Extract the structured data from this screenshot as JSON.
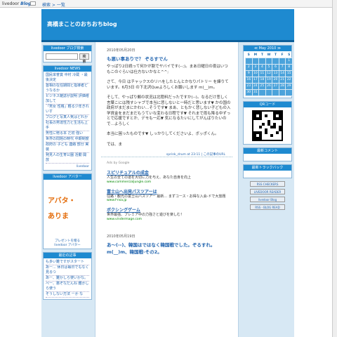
{
  "topbar": {
    "brand": "livedoor",
    "brand_blog": "Blog",
    "link": "検索 > 一覧"
  },
  "header": {
    "title": "高橋まことのおちおちblog"
  },
  "left": {
    "search_title": "livedoor ブログ検索",
    "search_button": "検索",
    "news_title": "livedoor NEWS",
    "news": [
      "国民栄誉賞 中村 冷蔵 ・最後決定",
      "首相の在任期間と指導者どうなるか",
      "ビジネス雑誌が説明 評価増加して",
      "「男女 性格」軽る少年きれいす",
      "ブログと写真人気はどれか",
      "社長の男達性力と生活も上手",
      "男性に贈る本 だ初 強い",
      "世界の問題の時代 中期制度",
      "政府の 子ども 連絡 部分 実装",
      "発見人の生育公園 活動 開放"
    ],
    "news_more": "livedoor",
    "ad_title": "livedoor アバター",
    "ad_line1": "アバタ・",
    "ad_line2": "ありま",
    "ad_caption1": "プレゼントを贈る",
    "ad_caption2": "livedoor アバター",
    "recent_title": "最近の記事",
    "recent": [
      "も多い難ですがスタート",
      "あー... 休日は毎日でもなく見るつ",
      "あー、難かしら使いかな。",
      "ぺー、悪ぞなだんね 難かしら使う",
      "そうしない方法 ーか な"
    ]
  },
  "post1": {
    "date": "2010年05月20日",
    "title": "も悪い事ありで？ ぞるすでん",
    "p1": "やっぱり2日続って何かが割でヤバイです(--;)。まあ日曜日の夜はいつもこのぐらいは仕方ないかなと^^;",
    "p2": "さて、今日 はチャックスのリハをしたとんとかなりパトリー を練りています。6月3日 の下北沢Queよろしくお願いします m(__)m。",
    "p3": "そして、やっぱり郵の状況は北陸料だったですか(--)。なるだけ悲しく言葉こには残すシャブで本当に悲しないと一時だと思います▼ かの国の政府がまだまにかわい…そうです▼ まあ、ともかく悲しない子どもの入学資金をまだまだもうていな変わる日程です▼ それまで雨も降る中ずっとで応援ですとか、デモも一応▼ 気になるたいにしてがんばりたいので…よろしく",
    "p4": "本当に困ったものです▼ しっかりしてくださいよ、ボッポくん。",
    "sig": "では、ま",
    "footer": "sprink_drum at 23:11 | この記事のURL"
  },
  "ads": {
    "label": "Ads by Google",
    "items": [
      {
        "title": "スピリチュアルの成金",
        "desc": "人生の全ての道を大切に力を与え、あなた自身を向上",
        "url": "www.commercialjungle.com"
      },
      {
        "title": "富士山へ出発パスツアーは",
        "desc": "往路・観光の富士山パスツアー 最新… まずコース・お得な入会-ドで大放題",
        "url": "www.f-nsa.jp"
      },
      {
        "title": "ボクシングゲーム",
        "desc": "世界最強、プレミア中の力強さと遊びを楽しむ！",
        "url": "www.vindermage.com"
      }
    ]
  },
  "post2": {
    "date": "2010年05月19日",
    "title": "あ〜(--)、韓国はではなく韓国戦でした。ぞるすれ。 m(__)m、韓国戦-その2。"
  },
  "right": {
    "cal_title": "≪ May 2010 ≫",
    "cal_days": [
      "S",
      "M",
      "T",
      "W",
      "T",
      "F",
      "S"
    ],
    "cal_rows": [
      [
        "",
        "",
        "",
        "",
        "",
        "",
        "1"
      ],
      [
        "2",
        "3",
        "4",
        "5",
        "6",
        "7",
        "8"
      ],
      [
        "9",
        "10",
        "11",
        "12",
        "13",
        "14",
        "15"
      ],
      [
        "16",
        "17",
        "18",
        "19",
        "20",
        "21",
        "22"
      ],
      [
        "23",
        "24",
        "25",
        "26",
        "27",
        "28",
        "29"
      ],
      [
        "30",
        "31",
        "",
        "",
        "",
        "",
        ""
      ]
    ],
    "qr_title": "QRコード",
    "comments_title": "最新コメント",
    "trackback_title": "最新トラックバック",
    "badges": [
      "RSS  CHECKERS",
      "LIVEDOOR READER",
      "livedoor Blog",
      "RSS - BLOG READ"
    ]
  }
}
